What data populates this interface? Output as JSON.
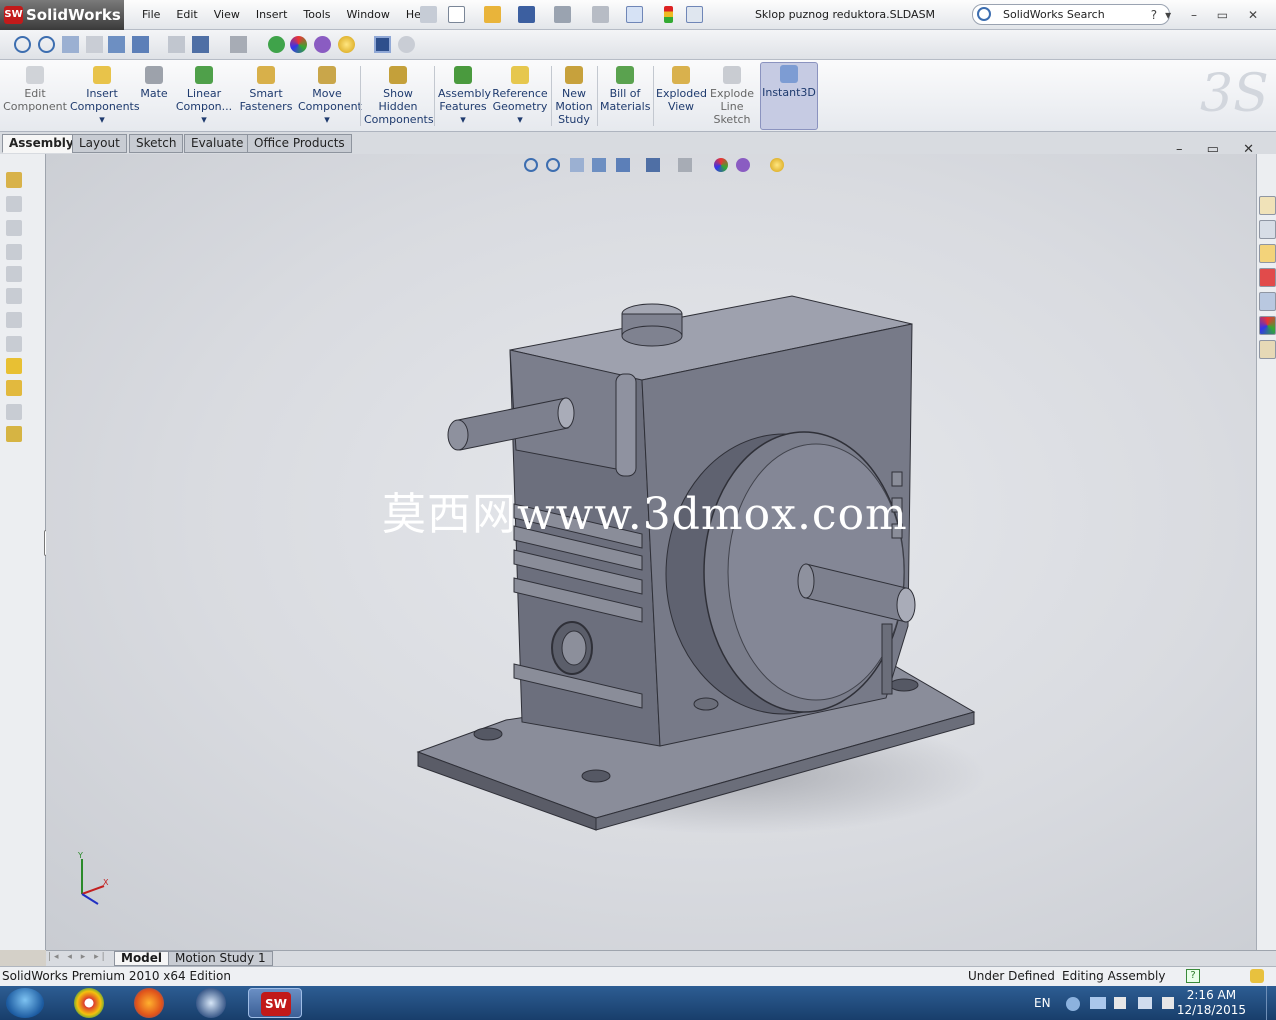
{
  "app": {
    "name": "SolidWorks",
    "logo_text": "SW"
  },
  "menu": [
    "File",
    "Edit",
    "View",
    "Insert",
    "Tools",
    "Window",
    "Help"
  ],
  "document_title": "Sklop puznog reduktora.SLDASM",
  "search": {
    "text": "SolidWorks Search"
  },
  "command_manager": [
    {
      "label": "Edit\nComponent",
      "enabled": false
    },
    {
      "label": "Insert\nComponents",
      "enabled": true
    },
    {
      "label": "Mate",
      "enabled": true
    },
    {
      "label": "Linear\nCompon...",
      "enabled": true
    },
    {
      "label": "Smart\nFasteners",
      "enabled": true
    },
    {
      "label": "Move\nComponent",
      "enabled": true
    },
    {
      "label": "Show\nHidden\nComponents",
      "enabled": true
    },
    {
      "label": "Assembly\nFeatures",
      "enabled": true
    },
    {
      "label": "Reference\nGeometry",
      "enabled": true
    },
    {
      "label": "New\nMotion\nStudy",
      "enabled": true
    },
    {
      "label": "Bill of\nMaterials",
      "enabled": true
    },
    {
      "label": "Exploded\nView",
      "enabled": true
    },
    {
      "label": "Explode\nLine\nSketch",
      "enabled": false
    },
    {
      "label": "Instant3D",
      "enabled": true,
      "active": true
    }
  ],
  "tabs": [
    "Assembly",
    "Layout",
    "Sketch",
    "Evaluate",
    "Office Products"
  ],
  "active_tab": "Assembly",
  "watermark": "莫西网www.3dmox.com",
  "triad": {
    "x": "X",
    "y": "Y"
  },
  "bottom_tabs": [
    "Model",
    "Motion Study 1"
  ],
  "status": {
    "edition": "SolidWorks Premium 2010 x64 Edition",
    "definition": "Under Defined",
    "mode": "Editing Assembly"
  },
  "taskbar": {
    "language": "EN",
    "time": "2:16 AM",
    "date": "12/18/2015"
  },
  "colors": {
    "model_body": "#6e717f",
    "model_light": "#9a9dab",
    "model_dark": "#4a4c56",
    "viewport_bg": "#dcdee3",
    "accent": "#c21a1a"
  }
}
